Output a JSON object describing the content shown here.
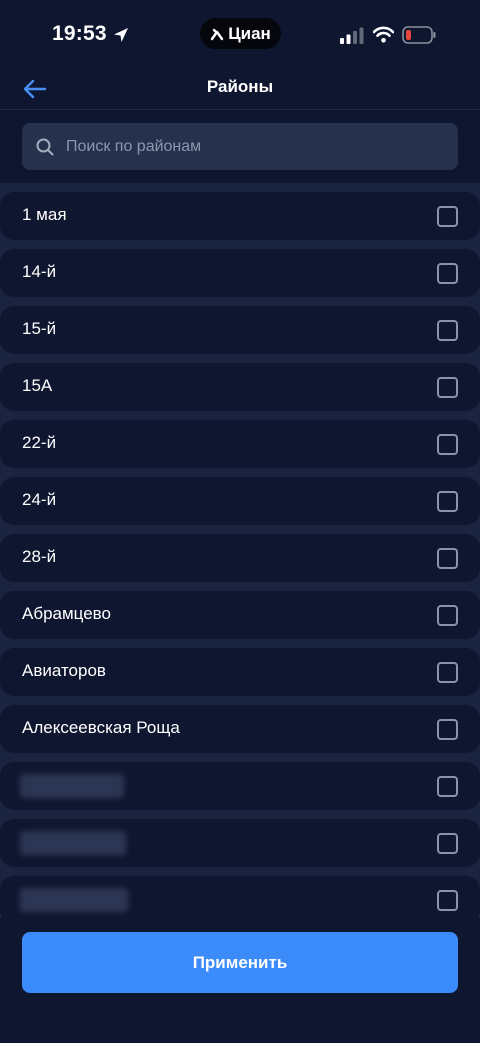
{
  "status_bar": {
    "time": "19:53",
    "app_name": "Циан",
    "battery_color": "#e5483a"
  },
  "header": {
    "title": "Районы",
    "back_icon": "arrow-left-icon"
  },
  "search": {
    "placeholder": "Поиск по районам",
    "value": ""
  },
  "districts": [
    {
      "label": "1 мая",
      "checked": false,
      "blurred": false
    },
    {
      "label": "14-й",
      "checked": false,
      "blurred": false
    },
    {
      "label": "15-й",
      "checked": false,
      "blurred": false
    },
    {
      "label": "15А",
      "checked": false,
      "blurred": false
    },
    {
      "label": "22-й",
      "checked": false,
      "blurred": false
    },
    {
      "label": "24-й",
      "checked": false,
      "blurred": false
    },
    {
      "label": "28-й",
      "checked": false,
      "blurred": false
    },
    {
      "label": "Абрамцево",
      "checked": false,
      "blurred": false
    },
    {
      "label": "Авиаторов",
      "checked": false,
      "blurred": false
    },
    {
      "label": "Алексеевская Роща",
      "checked": false,
      "blurred": false
    },
    {
      "label": "",
      "checked": false,
      "blurred": true
    },
    {
      "label": "",
      "checked": false,
      "blurred": true
    },
    {
      "label": "",
      "checked": false,
      "blurred": true
    }
  ],
  "footer": {
    "apply_label": "Применить"
  },
  "colors": {
    "background": "#0f1730",
    "separator": "#1a2440",
    "search_bg": "#26314e",
    "accent": "#3b8bfb"
  }
}
